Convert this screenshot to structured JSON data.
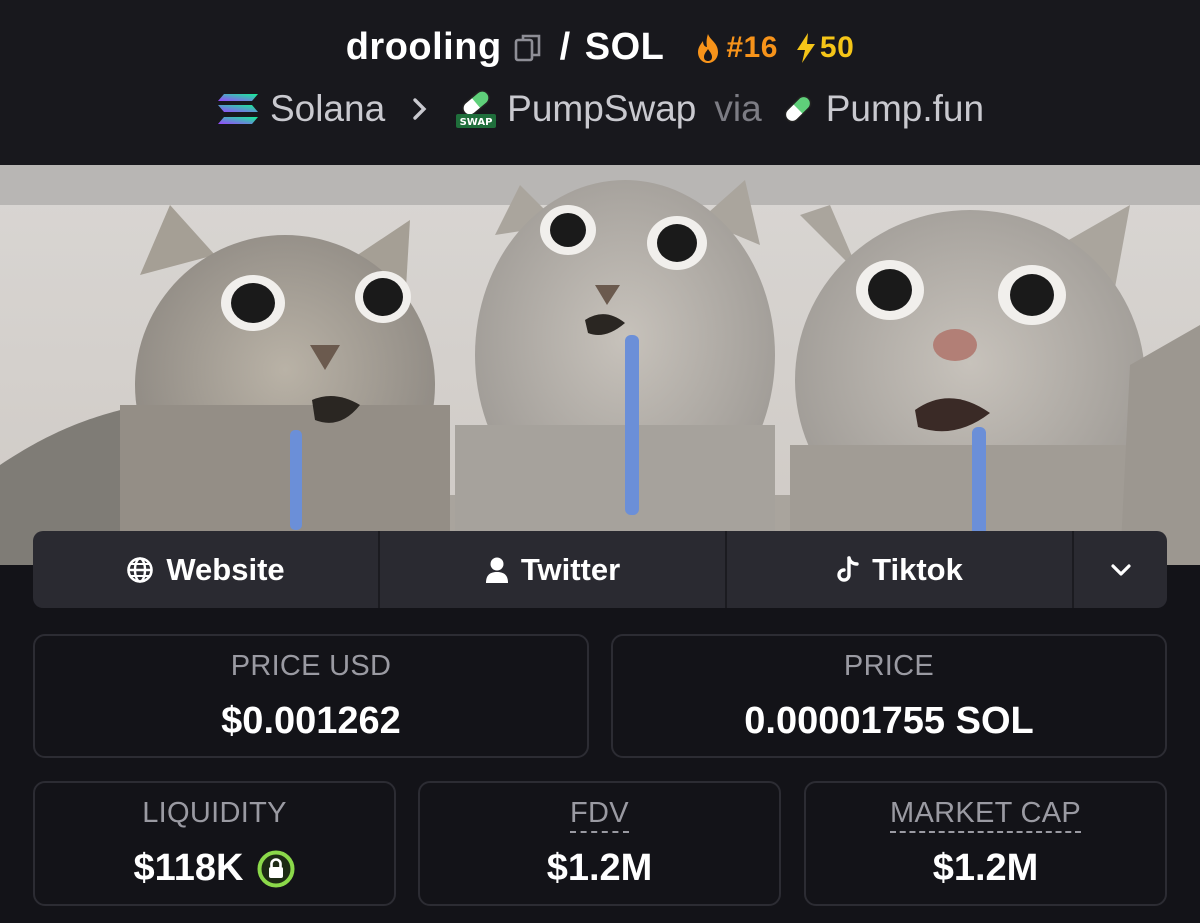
{
  "header": {
    "token": "drooling",
    "pair_separator": "/",
    "quote": "SOL",
    "rank": "#16",
    "boosts": "50",
    "chain": "Solana",
    "dex": "PumpSwap",
    "via": "via",
    "launchpad": "Pump.fun",
    "swap_badge": "SWAP"
  },
  "links": {
    "website": "Website",
    "twitter": "Twitter",
    "tiktok": "Tiktok"
  },
  "stats": {
    "price_usd_label": "PRICE USD",
    "price_usd": "$0.001262",
    "price_label": "PRICE",
    "price": "0.00001755 SOL",
    "liquidity_label": "LIQUIDITY",
    "liquidity": "$118K",
    "fdv_label": "FDV",
    "fdv": "$1.2M",
    "mcap_label": "MARKET CAP",
    "mcap": "$1.2M"
  },
  "colors": {
    "rank": "#f7931a",
    "boost": "#f5c518",
    "lock": "#7ed321",
    "background": "#131318"
  },
  "icons": [
    "copy-icon",
    "fire-icon",
    "lightning-icon",
    "solana-icon",
    "chevron-right-icon",
    "pumpswap-icon",
    "pill-icon",
    "globe-icon",
    "user-icon",
    "tiktok-icon",
    "chevron-down-icon",
    "lock-icon"
  ]
}
